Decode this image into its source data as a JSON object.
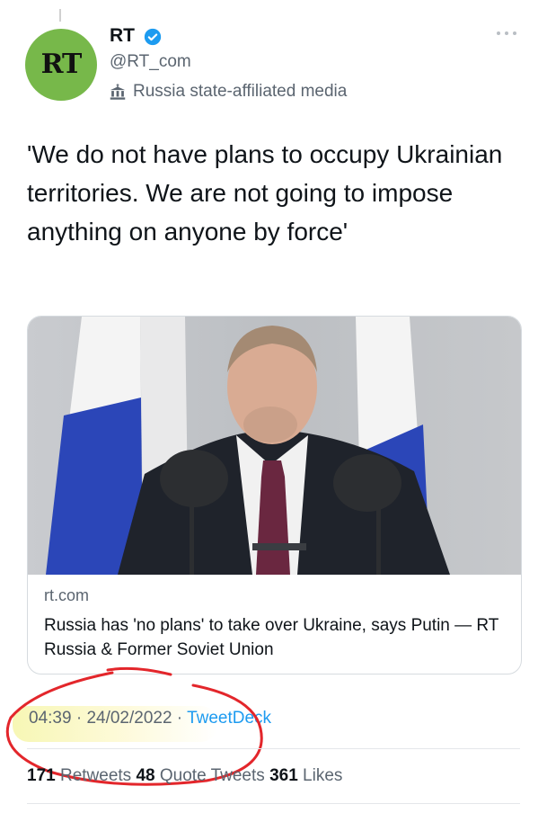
{
  "account": {
    "display_name": "RT",
    "handle": "@RT_com",
    "label": "Russia state-affiliated media",
    "avatar_text": "RT"
  },
  "tweet": {
    "text": "'We do not have plans to occupy Ukrainian territories. We are not going to impose anything on anyone by force'"
  },
  "card": {
    "domain": "rt.com",
    "title": "Russia has 'no plans' to take over Ukraine, says Putin — RT Russia & Former Soviet Union"
  },
  "meta": {
    "time": "04:39",
    "separator1": " · ",
    "date": "24/02/2022",
    "separator2": " · ",
    "source": "TweetDeck"
  },
  "stats": {
    "retweets_count": "171",
    "retweets_label": " Retweets  ",
    "quotes_count": "48",
    "quotes_label": " Quote Tweets  ",
    "likes_count": "361",
    "likes_label": " Likes"
  },
  "colors": {
    "avatar_bg": "#77b84a",
    "verified": "#1d9bf0",
    "annotation": "#e3262b",
    "link": "#1d9bf0"
  },
  "icons": {
    "verified": "verified-badge-icon",
    "label": "government-building-icon",
    "more": "more-icon"
  }
}
